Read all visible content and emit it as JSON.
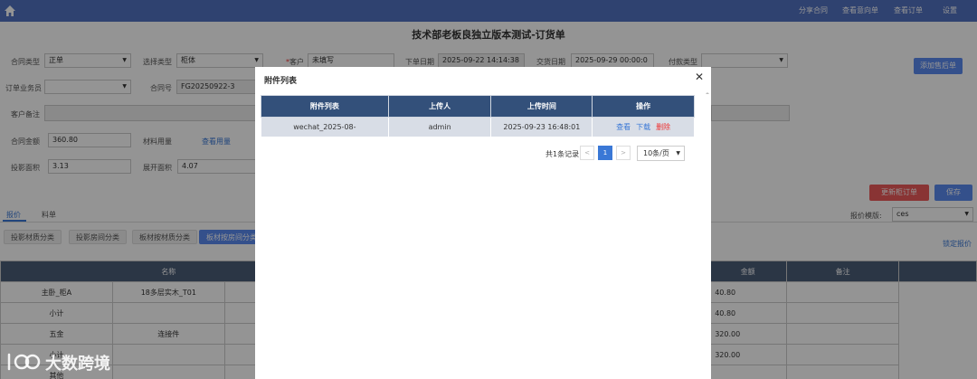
{
  "nav": {
    "links": [
      "分享合同",
      "查看意向单",
      "查看订单",
      "设置"
    ]
  },
  "page": {
    "title": "技术部老板良独立版本测试-订货单"
  },
  "form": {
    "contract_type_label": "合同类型",
    "contract_type_value": "正单",
    "select_type_label": "选择类型",
    "select_type_value": "柜体",
    "customer_label": "客户",
    "customer_value": "未填写",
    "order_date_label": "下单日期",
    "order_date_value": "2025-09-22 14:14:38",
    "delivery_date_label": "交货日期",
    "delivery_date_value": "2025-09-29 00:00:0",
    "payment_type_label": "付款类型",
    "payment_type_value": "",
    "salesperson_label": "订单业务员",
    "salesperson_value": "",
    "contract_no_label": "合同号",
    "contract_no_value": "FG20250922-3",
    "customer_note_label": "客户备注",
    "amount_label": "合同金额",
    "amount_value": "360.80",
    "material_usage_label": "材料用量",
    "material_usage_link": "查看用量",
    "projection_area_label": "投影面积",
    "projection_area_value": "3.13",
    "unfold_area_label": "展开面积",
    "unfold_area_value": "4.07",
    "add_after_sale": "添加售后单",
    "update_cabinet_order": "更新柜订单",
    "save": "保存"
  },
  "tabs": {
    "quote": "报价",
    "material": "料单"
  },
  "quote_template": {
    "label": "报价模版:",
    "value": "ces"
  },
  "lock_quote": "锁定报价",
  "categories": [
    "投影材质分类",
    "投影房间分类",
    "板材按材质分类",
    "板材按房间分类"
  ],
  "table": {
    "headers": {
      "name": "名称",
      "amount": "金额",
      "note": "备注"
    },
    "rows": [
      {
        "name": "主卧_柜A",
        "sub": "18多层实木_T01",
        "amount": "40.80"
      },
      {
        "name": "小计",
        "sub": "",
        "amount": "40.80"
      },
      {
        "name": "五金",
        "sub": "连接件",
        "amount": "320.00"
      },
      {
        "name": "小计",
        "sub": "",
        "amount": "320.00"
      },
      {
        "name": "其他",
        "sub": "",
        "amount": ""
      }
    ]
  },
  "modal": {
    "title": "附件列表",
    "columns": [
      "附件列表",
      "上传人",
      "上传时间",
      "操作"
    ],
    "rows": [
      {
        "file": "wechat_2025-08-",
        "uploader": "admin",
        "time": "2025-09-23 16:48:01",
        "view": "查看",
        "download": "下载",
        "delete": "删除"
      }
    ],
    "pagination": {
      "total": "共1条记录",
      "current": "1",
      "prev": "<",
      "next": ">",
      "page_size": "10条/页"
    }
  },
  "watermark": {
    "text": "大数跨境"
  },
  "colors": {
    "nav_bg": "#5272c2",
    "modal_header": "#33507a",
    "primary": "#3a78d6",
    "danger": "#e33333"
  }
}
